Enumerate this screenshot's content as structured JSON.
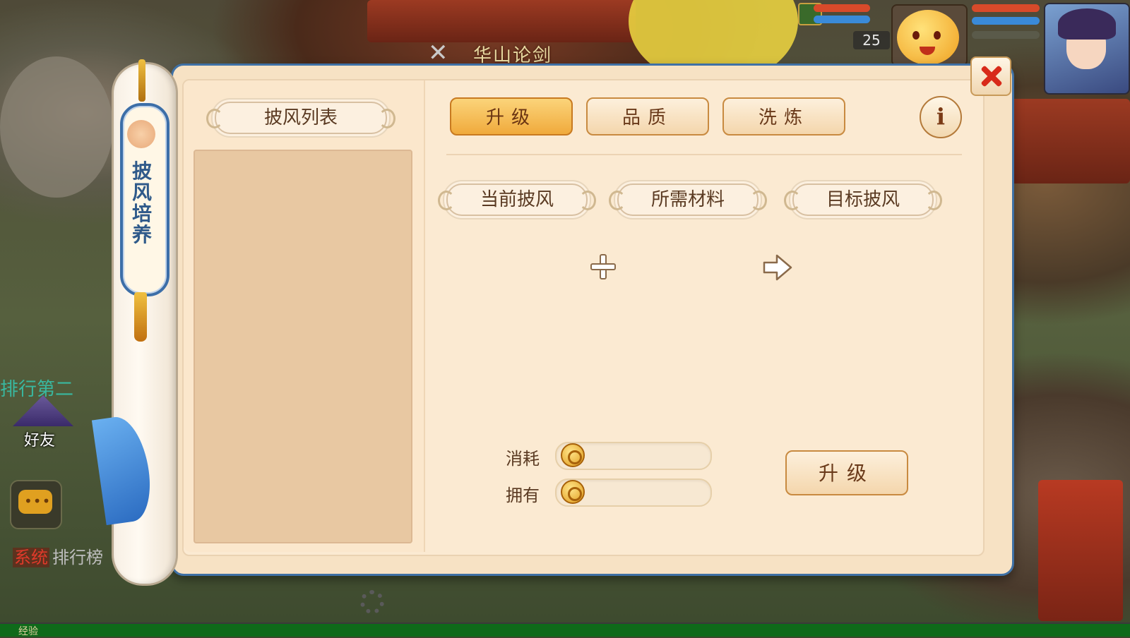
{
  "hud": {
    "map_title": "华山论剑",
    "pet_level": "25",
    "rank_text": "排行第二",
    "friend_label": "好友",
    "system_tag": "系统",
    "system_msg": "排行榜",
    "exp_label": "经验",
    "hp_color": "#d84a2a",
    "mp_color": "#3a8ad8"
  },
  "side_tab": {
    "title": "披风培养"
  },
  "panel": {
    "list_title": "披风列表",
    "tabs": [
      {
        "label": "升级",
        "active": true
      },
      {
        "label": "品质",
        "active": false
      },
      {
        "label": "洗炼",
        "active": false
      }
    ],
    "info_label": "i",
    "current_label": "当前披风",
    "material_label": "所需材料",
    "target_label": "目标披风",
    "cost_label": "消耗",
    "own_label": "拥有",
    "cost_value": "",
    "own_value": "",
    "upgrade_label": "升级",
    "icons": [
      "plus-icon",
      "arrow-right-icon",
      "coin-icon",
      "close-icon",
      "info-icon"
    ]
  }
}
